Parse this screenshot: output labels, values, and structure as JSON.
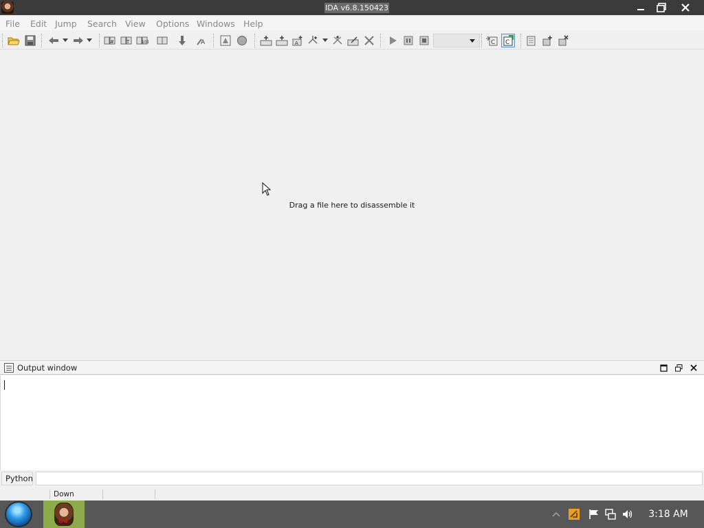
{
  "window": {
    "title": "IDA v6.8.150423",
    "app_icon": "ida-icon",
    "controls": [
      "minimize-icon",
      "restore-icon",
      "close-icon"
    ]
  },
  "menu": {
    "items": [
      {
        "label": "File"
      },
      {
        "label": "Edit"
      },
      {
        "label": "Jump"
      },
      {
        "label": "Search"
      },
      {
        "label": "View"
      },
      {
        "label": "Options"
      },
      {
        "label": "Windows"
      },
      {
        "label": "Help"
      }
    ]
  },
  "toolbar": {
    "icons": [
      "open-icon",
      "save-icon",
      "back-icon",
      "forward-icon",
      "search-text-icon",
      "search-code-icon",
      "search-bytes-icon",
      "search-next-icon",
      "jump-down-icon",
      "patch-icon",
      "segment-icon",
      "graph-icon",
      "add-code-icon",
      "add-data-icon",
      "add-string-icon",
      "add-struct-icon",
      "add-enum-icon",
      "add-array-icon",
      "undefine-icon",
      "run-icon",
      "pause-icon",
      "stop-icon",
      "debugger-select",
      "switch-debugger-icon",
      "view-pseudo-icon",
      "options-icon",
      "add-breakpoint-icon",
      "remove-breakpoint-icon"
    ],
    "debugger_select_value": ""
  },
  "workspace": {
    "hint": "Drag a file here to disassemble it"
  },
  "output_window": {
    "title": "Output window",
    "content": ""
  },
  "command_line": {
    "language": "Python",
    "value": ""
  },
  "status": {
    "state": "Down"
  },
  "taskbar": {
    "start_icon": "start-orb-icon",
    "apps": [
      {
        "name": "ida-taskbar-icon"
      }
    ],
    "tray": [
      "show-hidden-icons",
      "ida-tray-icon",
      "flag-icon",
      "network-icon",
      "volume-icon"
    ],
    "clock": "3:18 AM"
  },
  "colors": {
    "titlebar": "#3b3b3b",
    "background": "#f0f0f0",
    "taskbar": "#575757",
    "taskbar_app": "#8cab4a"
  }
}
